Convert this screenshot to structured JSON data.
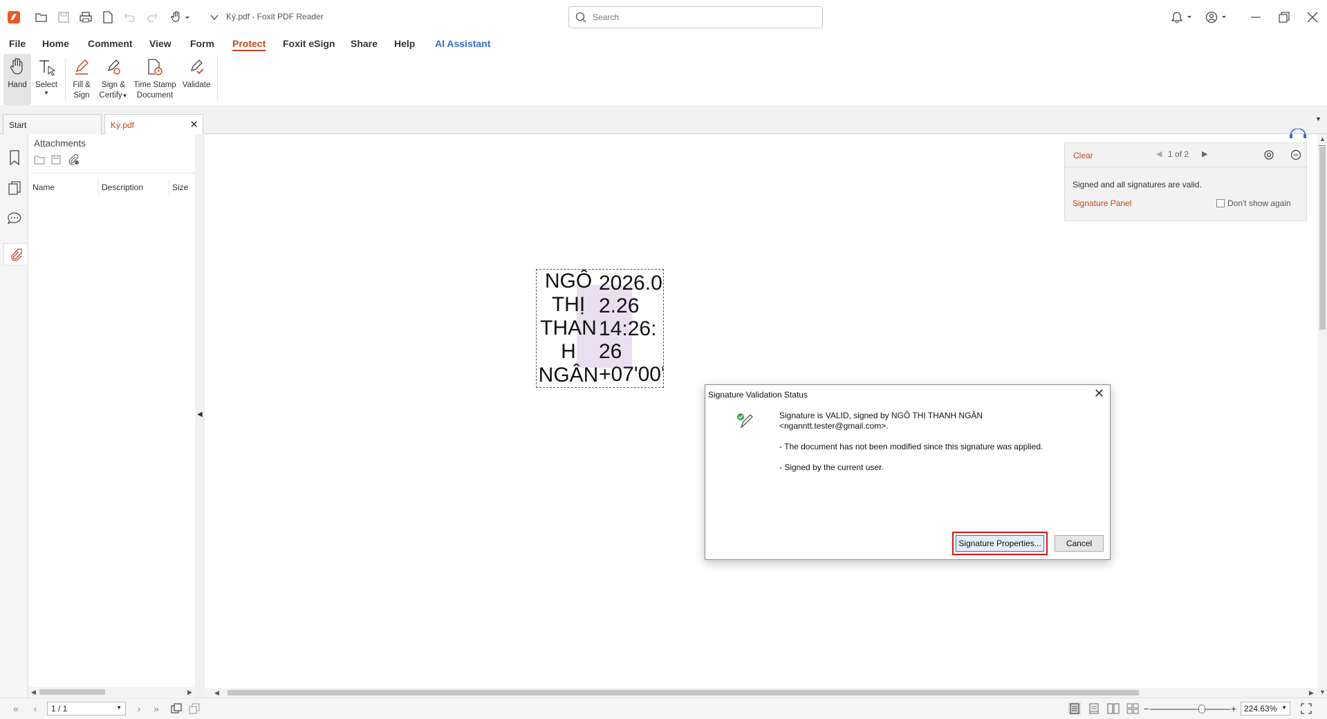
{
  "app": {
    "title": "Ký.pdf - Foxit PDF Reader",
    "search_placeholder": "Search"
  },
  "menu": [
    "File",
    "Home",
    "Comment",
    "View",
    "Form",
    "Protect",
    "Foxit eSign",
    "Share",
    "Help",
    "AI Assistant"
  ],
  "menu_active": "Protect",
  "ribbon": {
    "hand": "Hand",
    "select": "Select",
    "fill_sign_1": "Fill &",
    "fill_sign_2": "Sign",
    "sign_certify_1": "Sign &",
    "sign_certify_2": "Certify",
    "timestamp_1": "Time Stamp",
    "timestamp_2": "Document",
    "validate": "Validate"
  },
  "tabs": {
    "start": "Start",
    "doc": "Ký.pdf"
  },
  "attachments": {
    "title": "Attachments",
    "columns": [
      "Name",
      "Description",
      "Size"
    ]
  },
  "signature_stamp": {
    "name": "NGÔ\nTHỊ\nTHAN\nH\nNGÂN",
    "date": "2026.0\n2.26\n14:26:\n26\n+07'00'"
  },
  "notification": {
    "clear": "Clear",
    "pager": "1 of 2",
    "message": "Signed and all signatures are valid.",
    "link": "Signature Panel",
    "dont_show": "Don't show again"
  },
  "dialog": {
    "title": "Signature Validation Status",
    "line1": "Signature is VALID, signed by NGÔ THỊ THANH NGÂN",
    "line1b": "<nganntt.tester@gmail.com>.",
    "line2": "- The document has not been modified since this signature was applied.",
    "line3": "- Signed by the current user.",
    "btn_properties": "Signature Properties...",
    "btn_cancel": "Cancel"
  },
  "status": {
    "page": "1 / 1",
    "zoom": "224.63%"
  },
  "colors": {
    "accent": "#c4441d",
    "ai": "#3a6ad6",
    "highlight_box": "#dd1111"
  }
}
